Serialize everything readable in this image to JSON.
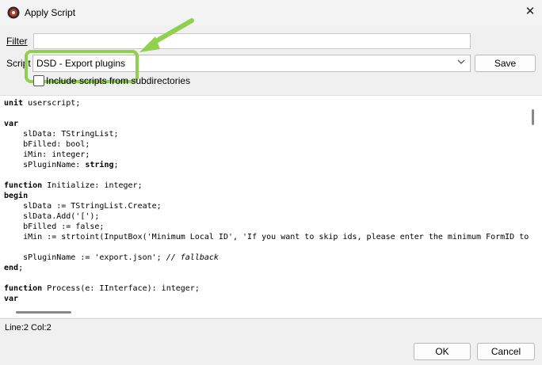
{
  "window": {
    "title": "Apply Script",
    "close_glyph": "✕"
  },
  "filter": {
    "label": "Filter",
    "value": ""
  },
  "script": {
    "label": "Script",
    "selected": "DSD - Export plugins"
  },
  "save_label": "Save",
  "include_subdirs": {
    "label": "Include scripts from subdirectories",
    "checked": false
  },
  "code_lines": [
    "unit userscript;",
    "",
    "var",
    "    slData: TStringList;",
    "    bFilled: bool;",
    "    iMin: integer;",
    "    sPluginName: string;",
    "",
    "function Initialize: integer;",
    "begin",
    "    slData := TStringList.Create;",
    "    slData.Add('[');",
    "    bFilled := false;",
    "    iMin := strtoint(InputBox('Minimum Local ID', 'If you want to skip ids, please enter the minimum FormID to",
    "",
    "    sPluginName := 'export.json'; // fallback",
    "end;",
    "",
    "function Process(e: IInterface): integer;",
    "var"
  ],
  "status": {
    "text": "Line:2 Col:2"
  },
  "buttons": {
    "ok": "OK",
    "cancel": "Cancel"
  },
  "colors": {
    "highlight": "#8fd14f",
    "window_bg": "#f0f0f0"
  }
}
